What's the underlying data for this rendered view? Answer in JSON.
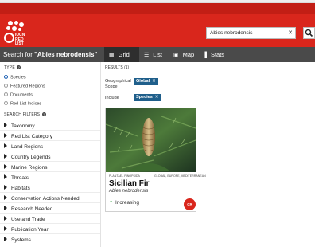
{
  "header": {
    "logo_text": "IUCN RED LIST",
    "search_value": "Abies nebrodensis",
    "clear_icon": "close-icon",
    "search_icon": "search-icon"
  },
  "toolbar": {
    "title_prefix": "Search for",
    "title_query": "\"Abies nebrodensis\"",
    "tabs": [
      {
        "label": "Grid",
        "icon": "grid-icon",
        "symbol": "▦",
        "active": true
      },
      {
        "label": "List",
        "icon": "list-icon",
        "symbol": "☰",
        "active": false
      },
      {
        "label": "Map",
        "icon": "map-icon",
        "symbol": "▣",
        "active": false
      },
      {
        "label": "Stats",
        "icon": "stats-icon",
        "symbol": "▐",
        "active": false
      }
    ]
  },
  "sidebar": {
    "type_label": "TYPE",
    "types": [
      {
        "label": "Species",
        "selected": true
      },
      {
        "label": "Featured Regions",
        "selected": false
      },
      {
        "label": "Documents",
        "selected": false
      },
      {
        "label": "Red List Indices",
        "selected": false
      }
    ],
    "filters_label": "SEARCH FILTERS",
    "filters": [
      "Taxonomy",
      "Red List Category",
      "Land Regions",
      "Country Legends",
      "Marine Regions",
      "Threats",
      "Habitats",
      "Conservation Actions Needed",
      "Research Needed",
      "Use and Trade",
      "Publication Year",
      "Systems"
    ]
  },
  "main": {
    "results_label": "RESULTS (1)",
    "filters": [
      {
        "label": "Geographical Scope",
        "chip": "Global"
      },
      {
        "label": "Include",
        "chip": "Species"
      }
    ],
    "card": {
      "taxonomy": "PLANTAE - PINOPSIDA",
      "scope": "GLOBAL, EUROPE, MEDITERRANEAN",
      "common_name": "Sicilian Fir",
      "scientific_name": "Abies nebrodensis",
      "trend": "Increasing",
      "trend_icon": "arrow-up-icon",
      "category": "CR",
      "category_color": "#d9261c"
    }
  },
  "colors": {
    "brand_red": "#d9261c",
    "toolbar": "#4a4a4a",
    "chip_blue": "#1f5f8b",
    "trend_green": "#2e9e3a"
  }
}
